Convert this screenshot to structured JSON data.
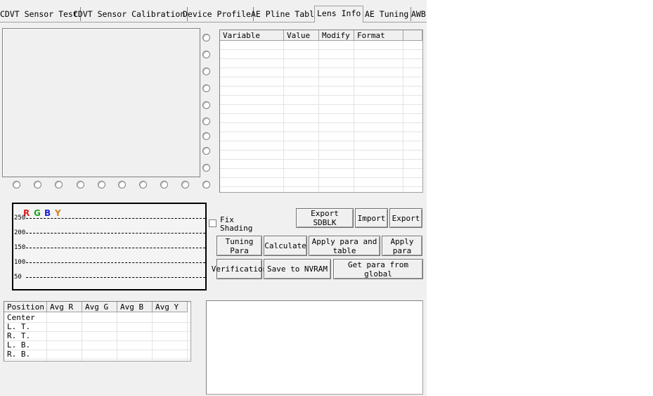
{
  "tabs": [
    {
      "label": "CDVT Sensor Test"
    },
    {
      "label": "CDVT Sensor Calibration"
    },
    {
      "label": "Device Profile"
    },
    {
      "label": "AE Pline Table"
    },
    {
      "label": "Lens Info"
    },
    {
      "label": "AE Tuning"
    },
    {
      "label": "AWB"
    }
  ],
  "variable_table": {
    "headers": [
      "Variable",
      "Value",
      "Modify",
      "Format"
    ]
  },
  "chart": {
    "legend": [
      {
        "label": "R",
        "color": "#e02020"
      },
      {
        "label": "G",
        "color": "#20a020"
      },
      {
        "label": "B",
        "color": "#2020d0"
      },
      {
        "label": "Y",
        "color": "#d08020"
      }
    ],
    "y_ticks": [
      "250",
      "200",
      "150",
      "100",
      "50"
    ]
  },
  "fix_shading": {
    "label": "Fix Shading",
    "checked": false
  },
  "buttons": {
    "export_sdblk": "Export SDBLK",
    "import": "Import",
    "export": "Export",
    "tuning_para": "Tuning Para",
    "calculate": "Calculate",
    "apply_para_and_table": "Apply para and table",
    "apply_para": "Apply para",
    "verification": "Verification",
    "save_to_nvram": "Save to NVRAM",
    "get_para_from_global": "Get para from global"
  },
  "avg_table": {
    "headers": [
      "Position",
      "Avg R",
      "Avg G",
      "Avg B",
      "Avg Y"
    ],
    "rows": [
      "Center",
      "L. T.",
      "R. T.",
      "L. B.",
      "R. B."
    ]
  }
}
